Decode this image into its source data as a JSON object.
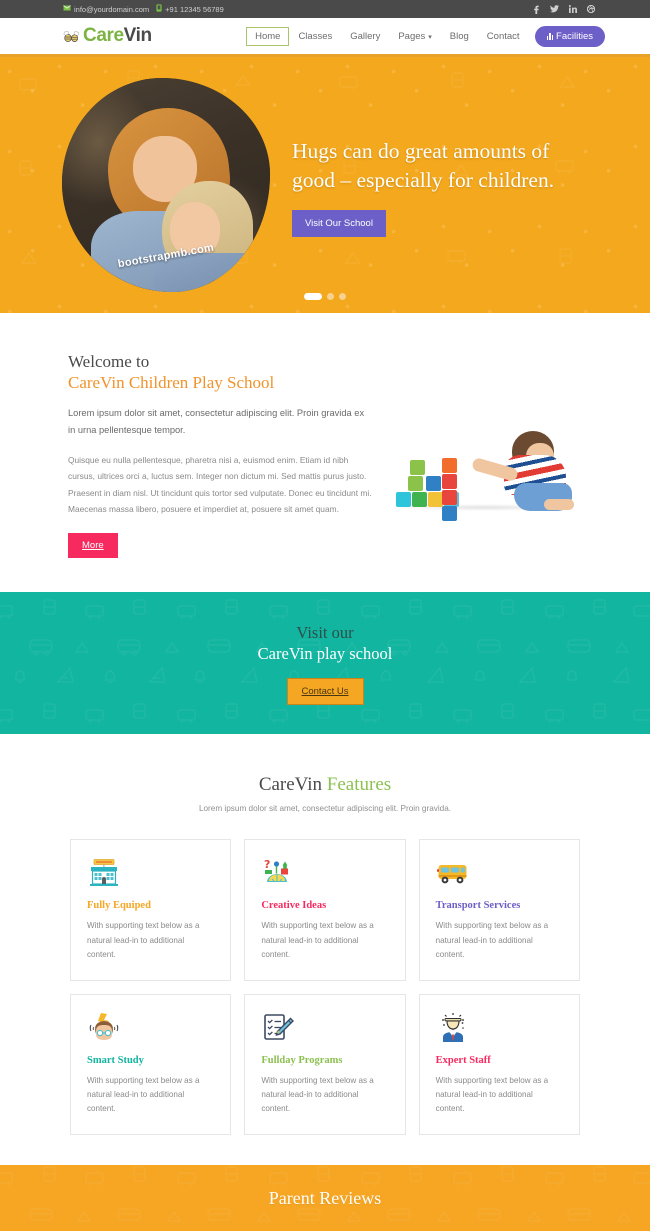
{
  "topbar": {
    "email": "info@yourdomain.com",
    "phone": "+91 12345 56789",
    "mail_icon": "envelope-icon",
    "phone_icon": "phone-icon",
    "socials": [
      {
        "name": "facebook-icon",
        "glyph": "f"
      },
      {
        "name": "twitter-icon",
        "glyph": "t"
      },
      {
        "name": "linkedin-icon",
        "glyph": "in"
      },
      {
        "name": "dribbble-icon",
        "glyph": "d"
      }
    ]
  },
  "header": {
    "logo_icon": "bees-logo-icon",
    "logo_part1": "Care",
    "logo_part2": "Vin",
    "nav": [
      {
        "label": "Home",
        "active": true
      },
      {
        "label": "Classes",
        "active": false
      },
      {
        "label": "Gallery",
        "active": false
      },
      {
        "label": "Pages",
        "active": false,
        "caret": "∨"
      },
      {
        "label": "Blog",
        "active": false
      },
      {
        "label": "Contact",
        "active": false
      }
    ],
    "facilities_label": "Facilities",
    "facilities_icon": "bars-chart-icon",
    "accent_border": "#e8a22a"
  },
  "hero": {
    "bg_color": "#f4a81d",
    "photo_alt": "two-girls-hugging-photo",
    "watermark": "bootstrapmb.com",
    "title": "Hugs can do great amounts of good – especially for children.",
    "button_label": "Visit Our School",
    "button_color": "#6c5fc7",
    "slides": [
      {
        "active": true
      },
      {
        "active": false
      },
      {
        "active": false
      }
    ]
  },
  "welcome": {
    "heading_line1": "Welcome to",
    "heading_line2": "CareVin Children Play School",
    "heading_accent_color": "#f0932b",
    "lead": "Lorem ipsum dolor sit amet, consectetur adipiscing elit. Proin gravida ex in urna pellentesque tempor.",
    "body": "Quisque eu nulla pellentesque, pharetra nisi a, euismod enim. Etiam id nibh cursus, ultrices orci a, luctus sem. Integer non dictum mi. Sed mattis purus justo. Praesent in diam nisl. Ut tincidunt quis tortor sed vulputate. Donec eu tincidunt mi. Maecenas massa libero, posuere et imperdiet at, posuere sit amet quam.",
    "button_label": "More",
    "button_color": "#f72a60",
    "image_alt": "boy-playing-with-blocks-photo"
  },
  "visit_band": {
    "bg_color": "#12b5a0",
    "heading_line1": "Visit our",
    "heading_line2": "CareVin play school",
    "button_label": "Contact Us",
    "button_color": "#f5a623"
  },
  "features": {
    "title_part1": "CareVin ",
    "title_part2": "Features",
    "title_accent_color": "#8cc152",
    "subtitle": "Lorem ipsum dolor sit amet, consectetur adipiscing elit. Proin gravida.",
    "body_text": "With supporting text below as a natural lead-in to additional content.",
    "cards": [
      {
        "icon": "school-building-icon",
        "title": "Fully Equiped",
        "color": "#f5a623",
        "text": "With supporting text below as a natural lead-in to additional content."
      },
      {
        "icon": "creative-toys-icon",
        "title": "Creative Ideas",
        "color": "#f72a60",
        "text": "With supporting text below as a natural lead-in to additional content."
      },
      {
        "icon": "school-bus-icon",
        "title": "Transport Services",
        "color": "#6c5fc7",
        "text": "With supporting text below as a natural lead-in to additional content."
      },
      {
        "icon": "smart-brain-icon",
        "title": "Smart Study",
        "color": "#12b5a0",
        "text": "With supporting text below as a natural lead-in to additional content."
      },
      {
        "icon": "checklist-pencil-icon",
        "title": "Fullday Programs",
        "color": "#8cc152",
        "text": "With supporting text below as a natural lead-in to additional content."
      },
      {
        "icon": "teacher-person-icon",
        "title": "Expert Staff",
        "color": "#f72a60",
        "text": "With supporting text below as a natural lead-in to additional content."
      }
    ]
  },
  "reviews": {
    "title": "Parent Reviews",
    "bg_color": "#f6a623"
  }
}
